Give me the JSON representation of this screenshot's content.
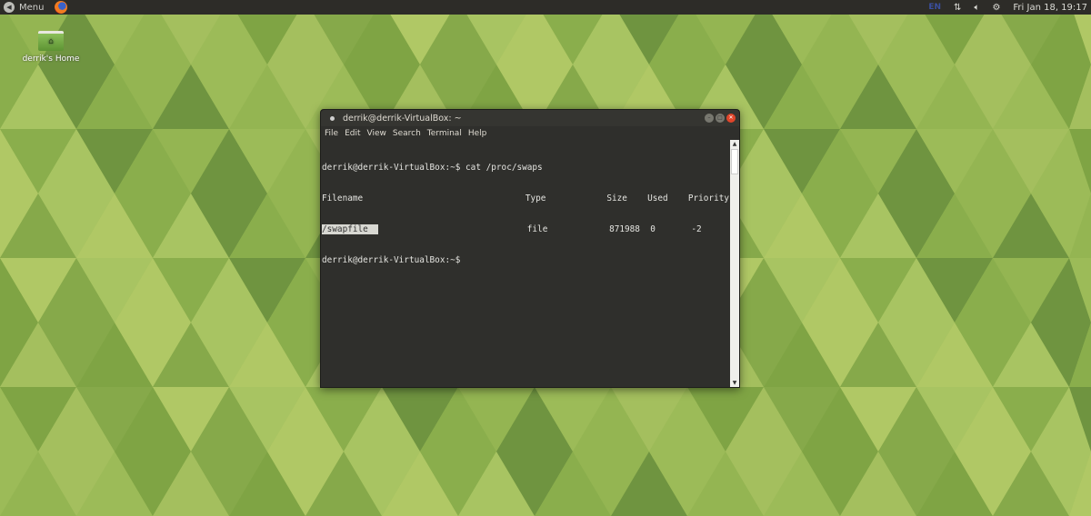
{
  "topbar": {
    "menu_label": "Menu",
    "keyboard_layout": "EN",
    "datetime": "Fri Jan 18, 19:17"
  },
  "desktop": {
    "home_icon_label": "derrik's Home"
  },
  "terminal": {
    "title": "derrik@derrik-VirtualBox: ~",
    "menu": [
      "File",
      "Edit",
      "View",
      "Search",
      "Terminal",
      "Help"
    ],
    "command_line": "derrik@derrik-VirtualBox:~$ cat /proc/swaps",
    "table": {
      "headers": [
        "Filename",
        "Type",
        "Size",
        "Used",
        "Priority"
      ],
      "rows": [
        [
          "/swapfile",
          "file",
          "871988",
          "0",
          "-2"
        ]
      ]
    },
    "prompt": "derrik@derrik-VirtualBox:~$"
  },
  "colors": {
    "panel": "#2d2c28",
    "terminal_bg": "#2f2f2c",
    "close": "#e0452a"
  }
}
